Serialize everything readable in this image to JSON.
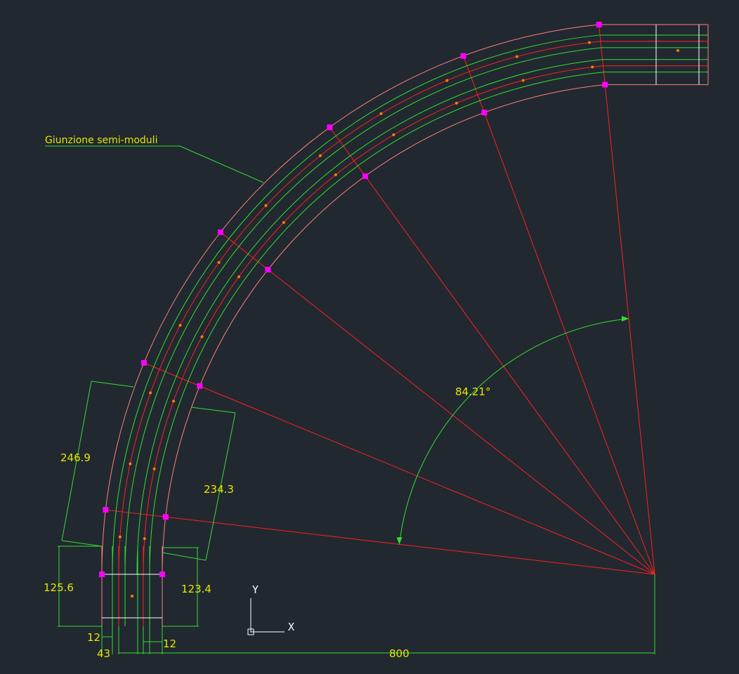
{
  "drawing": {
    "annotation": "Giunzione semi-moduli",
    "angle_label": "84.21°",
    "dimensions": {
      "outer_chord": "246.9",
      "inner_chord": "234.3",
      "outer_straight": "125.6",
      "inner_straight": "123.4",
      "left_offset": "12",
      "right_offset": "12",
      "inner_width": "43",
      "radius": "800"
    },
    "ucs": {
      "x_label": "X",
      "y_label": "Y"
    }
  },
  "colors": {
    "background": "#212830",
    "boundary": "#ff8080",
    "rail": "#33dd33",
    "centerline": "#ff2020",
    "grip": "#ff00ff",
    "node": "#ff8000",
    "dimension": "#33dd33",
    "text": "#e6e600"
  }
}
